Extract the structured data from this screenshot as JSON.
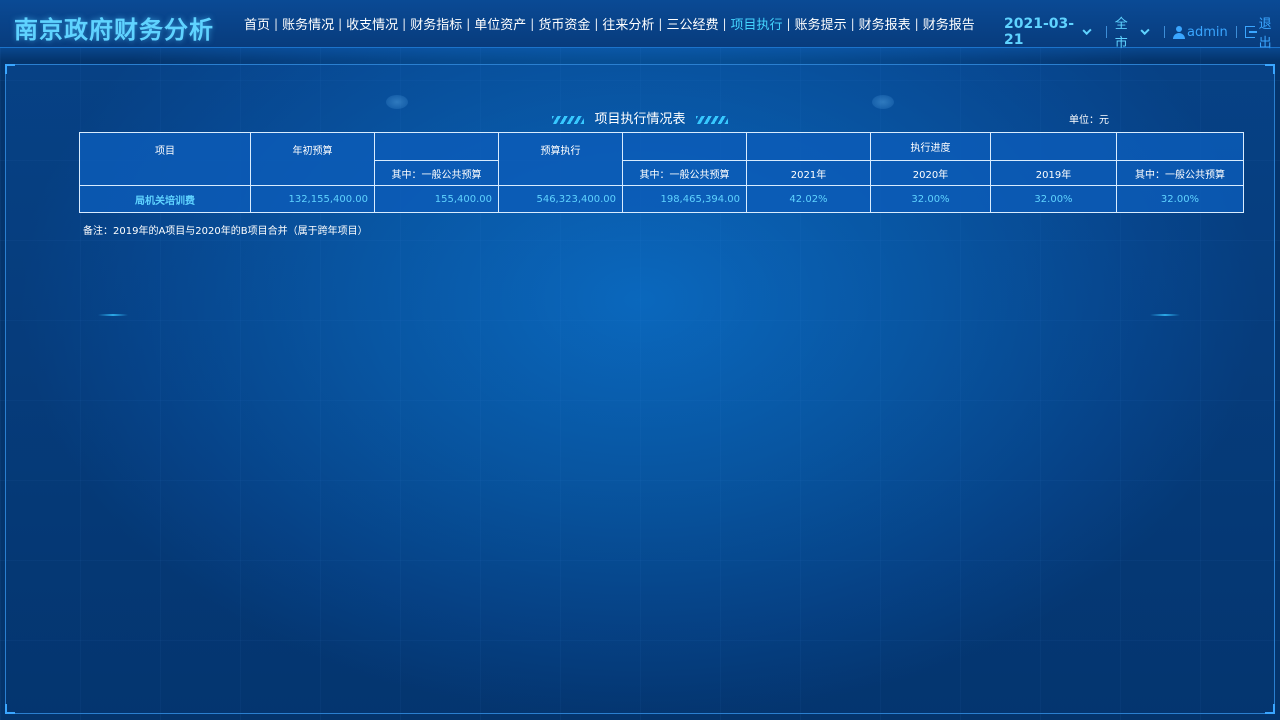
{
  "app": {
    "title": "南京政府财务分析"
  },
  "nav": {
    "items": [
      {
        "label": "首页",
        "active": false
      },
      {
        "label": "账务情况",
        "active": false
      },
      {
        "label": "收支情况",
        "active": false
      },
      {
        "label": "财务指标",
        "active": false
      },
      {
        "label": "单位资产",
        "active": false
      },
      {
        "label": "货币资金",
        "active": false
      },
      {
        "label": "往来分析",
        "active": false
      },
      {
        "label": "三公经费",
        "active": false
      },
      {
        "label": "项目执行",
        "active": true
      },
      {
        "label": "账务提示",
        "active": false
      },
      {
        "label": "财务报表",
        "active": false
      },
      {
        "label": "财务报告",
        "active": false
      }
    ],
    "separator": "|"
  },
  "header": {
    "date": "2021-03-21",
    "region": "全市",
    "username": "admin",
    "logout": "退出"
  },
  "table": {
    "title": "项目执行情况表",
    "unit": "单位：元",
    "headers": {
      "project": "项目",
      "initial_budget": "年初预算",
      "budget_execution": "预算执行",
      "execution_progress": "执行进度",
      "general_public_budget_1": "其中：一般公共预算",
      "general_public_budget_2": "其中：一般公共预算",
      "year_2021": "2021年",
      "year_2020": "2020年",
      "year_2019": "2019年",
      "general_public_budget_3": "其中：一般公共预算"
    },
    "rows": [
      {
        "project": "局机关培训费",
        "initial_budget": "132,155,400.00",
        "initial_general": "155,400.00",
        "execution": "546,323,400.00",
        "execution_general": "198,465,394.00",
        "p2021": "42.02%",
        "p2020": "32.00%",
        "p2019": "32.00%",
        "p_general": "32.00%"
      }
    ],
    "note": "备注：2019年的A项目与2020年的B项目合并（属于跨年项目）"
  },
  "colors": {
    "accent": "#44d5ff",
    "value": "#5fd3ff",
    "link": "#3aa6ff"
  },
  "icons": [
    "chevron-down-icon",
    "user-icon",
    "logout-icon"
  ]
}
